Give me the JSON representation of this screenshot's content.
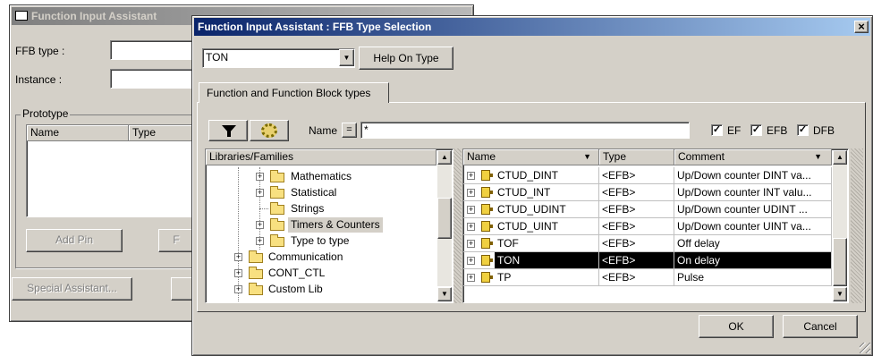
{
  "back_window": {
    "title": "Function Input Assistant",
    "ffb_type_label": "FFB type :",
    "ffb_type_value": "",
    "instance_label": "Instance :",
    "instance_value": "",
    "prototype_label": "Prototype",
    "columns": [
      "Name",
      "Type"
    ],
    "add_pin_label": "Add Pin",
    "remove_pin_label": "F",
    "special_assistant_label": "Special Assistant..."
  },
  "front_window": {
    "title": "Function Input Assistant : FFB Type Selection",
    "close_glyph": "×",
    "type_combo_value": "TON",
    "help_on_type_label": "Help On Type",
    "tab_label": "Function and Function Block types",
    "name_filter_label": "Name",
    "equals_label": "=",
    "name_filter_value": "*",
    "checkboxes": [
      {
        "label": "EF",
        "checked": true
      },
      {
        "label": "EFB",
        "checked": true
      },
      {
        "label": "DFB",
        "checked": true
      }
    ],
    "check_glyph": "✓",
    "ok_label": "OK",
    "cancel_label": "Cancel"
  },
  "tree": {
    "header": "Libraries/Families",
    "expander_glyph": "+",
    "items": [
      {
        "label": "Mathematics",
        "expander": true,
        "highlighted": false
      },
      {
        "label": "Statistical",
        "expander": true,
        "highlighted": false
      },
      {
        "label": "Strings",
        "expander": false,
        "highlighted": false
      },
      {
        "label": "Timers & Counters",
        "expander": true,
        "highlighted": true
      },
      {
        "label": "Type to type",
        "expander": true,
        "highlighted": false
      },
      {
        "label": "Communication",
        "expander": true,
        "highlighted": false
      },
      {
        "label": "CONT_CTL",
        "expander": true,
        "highlighted": false
      },
      {
        "label": "Custom Lib",
        "expander": true,
        "highlighted": false
      }
    ]
  },
  "blocks_table": {
    "headers": [
      "Name",
      "Type",
      "Comment"
    ],
    "sort_glyph": "▼",
    "rows": [
      {
        "name": "CTUD_DINT",
        "type": "<EFB>",
        "comment": "Up/Down counter DINT va...",
        "selected": false
      },
      {
        "name": "CTUD_INT",
        "type": "<EFB>",
        "comment": "Up/Down counter INT valu...",
        "selected": false
      },
      {
        "name": "CTUD_UDINT",
        "type": "<EFB>",
        "comment": "Up/Down counter UDINT ...",
        "selected": false
      },
      {
        "name": "CTUD_UINT",
        "type": "<EFB>",
        "comment": "Up/Down counter UINT va...",
        "selected": false
      },
      {
        "name": "TOF",
        "type": "<EFB>",
        "comment": "Off delay",
        "selected": false
      },
      {
        "name": "TON",
        "type": "<EFB>",
        "comment": "On delay",
        "selected": true
      },
      {
        "name": "TP",
        "type": "<EFB>",
        "comment": "Pulse",
        "selected": false
      }
    ]
  },
  "scroll_glyphs": {
    "up": "▲",
    "down": "▼",
    "combo": "▼"
  },
  "colors": {
    "active_title": "#0a246a",
    "selection": "#000000",
    "tree_highlight": "#d4d0c8",
    "face": "#d4d0c8"
  }
}
